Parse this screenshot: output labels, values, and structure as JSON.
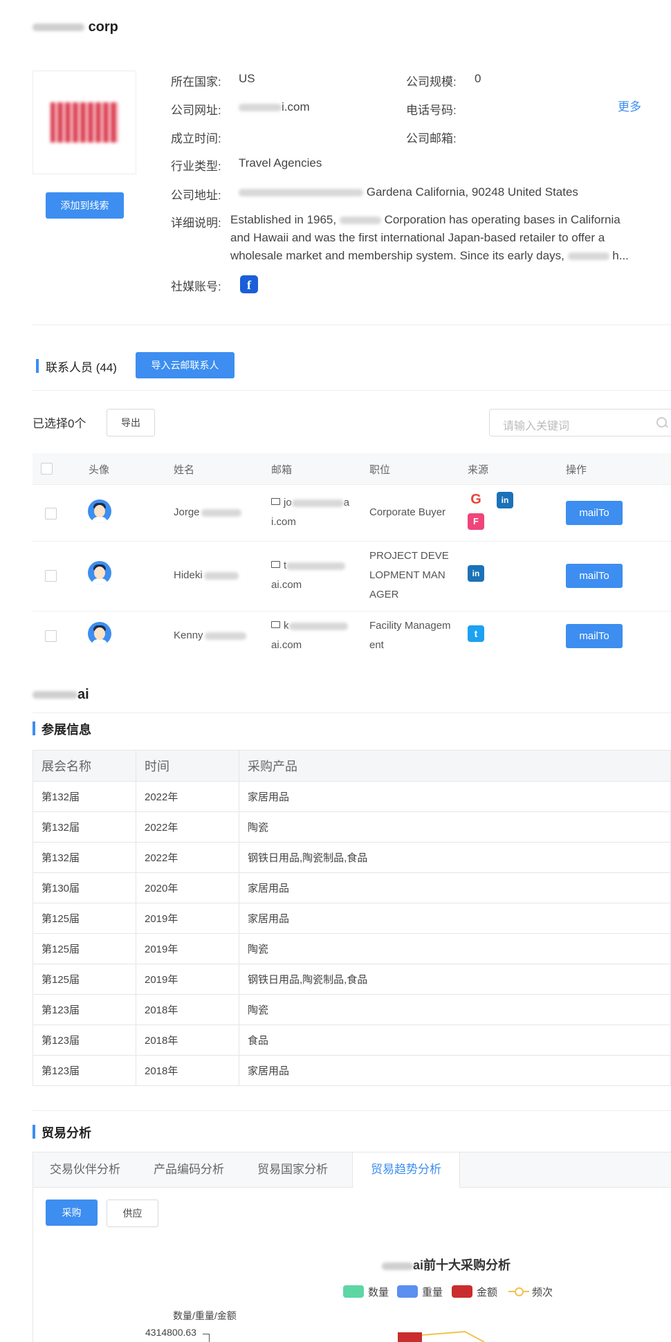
{
  "company": {
    "title": "corp",
    "add_button": "添加到线索",
    "fields": {
      "country_label": "所在国家:",
      "country_value": "US",
      "scale_label": "公司规模:",
      "scale_value": "0",
      "website_label": "公司网址:",
      "website_value": "i.com",
      "phone_label": "电话号码:",
      "founded_label": "成立时间:",
      "email_label": "公司邮箱:",
      "industry_label": "行业类型:",
      "industry_value": "Travel Agencies",
      "address_label": "公司地址:",
      "address_value": "Gardena California, 90248 United States",
      "desc_label": "详细说明:",
      "social_label": "社媒账号:"
    },
    "more_link": "更多",
    "description": {
      "line1_a": "Established in 1965,",
      "line1_b": "Corporation has operating bases in California",
      "line2": "and Hawaii and was the first international Japan-based retailer to offer a",
      "line3_a": "wholesale market and membership system. Since its early days,",
      "line3_b": "h..."
    },
    "social_icon": "facebook-icon"
  },
  "contacts": {
    "title": "联系人员 (44)",
    "import_button": "导入云邮联系人",
    "selected": "已选择0个",
    "export_button": "导出",
    "search_placeholder": "请输入关键词",
    "columns": [
      "头像",
      "姓名",
      "邮箱",
      "职位",
      "来源",
      "操作"
    ],
    "rows": [
      {
        "name": "Jorge",
        "email_a": "jo",
        "email_b": "i.com",
        "email_tail": "a",
        "title": "Corporate Buyer",
        "sources": [
          "google-icon",
          "linkedin-icon",
          "foursquare-icon"
        ],
        "action": "mailTo"
      },
      {
        "name": "Hideki",
        "email_a": "t",
        "email_b": "ai.com",
        "title_l1": "PROJECT DEVE",
        "title_l2": "LOPMENT MAN",
        "title_l3": "AGER",
        "sources": [
          "linkedin-icon"
        ],
        "action": "mailTo"
      },
      {
        "name": "Kenny",
        "email_a": "k",
        "email_b": "ai.com",
        "title_l1": "Facility Managem",
        "title_l2": "ent",
        "sources": [
          "twitter-icon"
        ],
        "action": "mailTo"
      }
    ]
  },
  "exhibition": {
    "company_name": "ai",
    "title": "参展信息",
    "columns": [
      "展会名称",
      "时间",
      "采购产品"
    ],
    "rows": [
      [
        "第132届",
        "2022年",
        "家居用品"
      ],
      [
        "第132届",
        "2022年",
        "陶瓷"
      ],
      [
        "第132届",
        "2022年",
        "钢铁日用品,陶瓷制品,食品"
      ],
      [
        "第130届",
        "2020年",
        "家居用品"
      ],
      [
        "第125届",
        "2019年",
        "家居用品"
      ],
      [
        "第125届",
        "2019年",
        "陶瓷"
      ],
      [
        "第125届",
        "2019年",
        "钢铁日用品,陶瓷制品,食品"
      ],
      [
        "第123届",
        "2018年",
        "陶瓷"
      ],
      [
        "第123届",
        "2018年",
        "食品"
      ],
      [
        "第123届",
        "2018年",
        "家居用品"
      ]
    ]
  },
  "trade": {
    "title": "贸易分析",
    "tabs": [
      "交易伙伴分析",
      "产品编码分析",
      "贸易国家分析",
      "贸易趋势分析"
    ],
    "active_tab": 3,
    "buy_button": "采购",
    "supply_button": "供应",
    "chart_title": "ai前十大采购分析",
    "legend": [
      {
        "label": "数量",
        "color": "#5ed6a4"
      },
      {
        "label": "重量",
        "color": "#5b8ff0"
      },
      {
        "label": "金额",
        "color": "#c92d2d"
      },
      {
        "label": "频次",
        "color": "#f2c14e"
      }
    ],
    "y_axis_label": "数量/重量/金额",
    "y_max_label": "4314800.63"
  },
  "colors": {
    "accent": "#3d8ef0"
  }
}
